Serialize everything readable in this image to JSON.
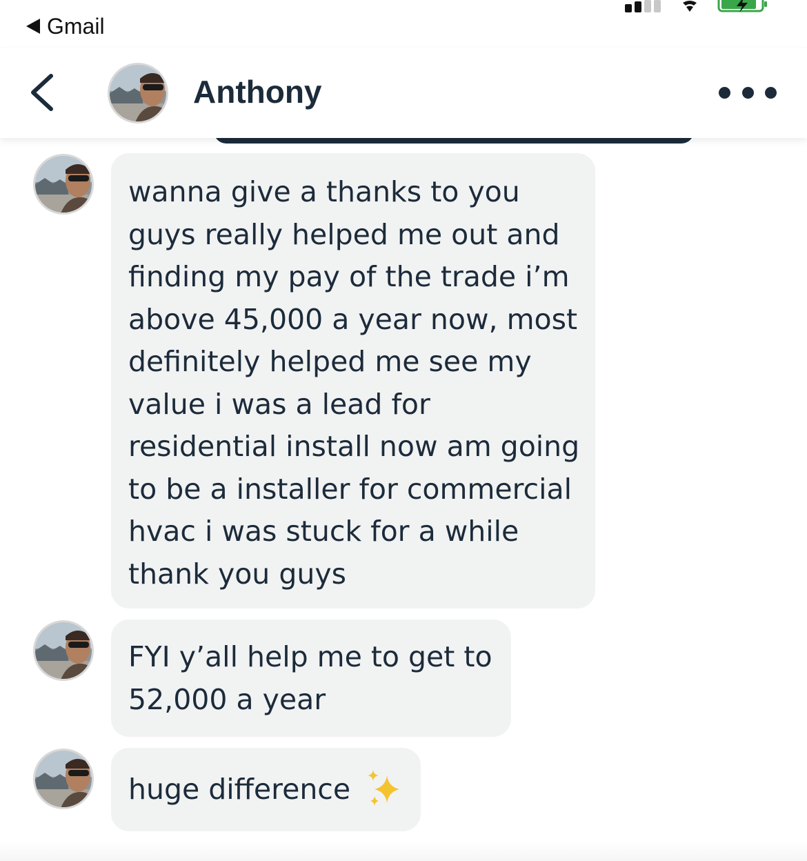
{
  "status_bar": {
    "back_app_label": "Gmail"
  },
  "header": {
    "contact_name": "Anthony",
    "back_icon": "chevron-left-icon",
    "more_icon": "more-horizontal-icon"
  },
  "messages": [
    {
      "sender": "Anthony",
      "text": "wanna give a thanks to you guys really helped me out and finding my pay of the trade i’m above 45,000 a year now, most definitely helped me see my value i was a lead for residential install now am going to be a installer for commercial hvac i was stuck for a while thank you guys"
    },
    {
      "sender": "Anthony",
      "text": "FYI y’all help me to get to 52,000 a year"
    },
    {
      "sender": "Anthony",
      "text": "huge difference",
      "emoji_icon": "sparkles-icon"
    }
  ],
  "colors": {
    "text": "#1c2b3a",
    "bubble": "#f1f2f2",
    "battery_fill": "#3aa64a",
    "sparkle": "#f4c430"
  }
}
